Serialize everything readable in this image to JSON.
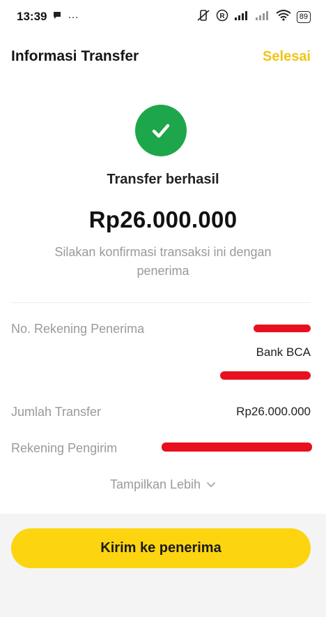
{
  "status_bar": {
    "time": "13:39",
    "more": "···",
    "battery": "89"
  },
  "header": {
    "title": "Informasi Transfer",
    "action_label": "Selesai"
  },
  "success": {
    "title": "Transfer berhasil",
    "amount": "Rp26.000.000",
    "subtitle": "Silakan konfirmasi transaksi ini dengan penerima",
    "icon_color": "#1ea64b"
  },
  "details": {
    "recipient_account_label": "No. Rekening Penerima",
    "recipient_bank": "Bank BCA",
    "transfer_amount_label": "Jumlah Transfer",
    "transfer_amount_value": "Rp26.000.000",
    "sender_account_label": "Rekening Pengirim"
  },
  "show_more_label": "Tampilkan Lebih",
  "primary_button_label": "Kirim ke penerima",
  "colors": {
    "accent": "#fcd40f",
    "action_text": "#f2c413",
    "redaction": "#e8101e"
  }
}
